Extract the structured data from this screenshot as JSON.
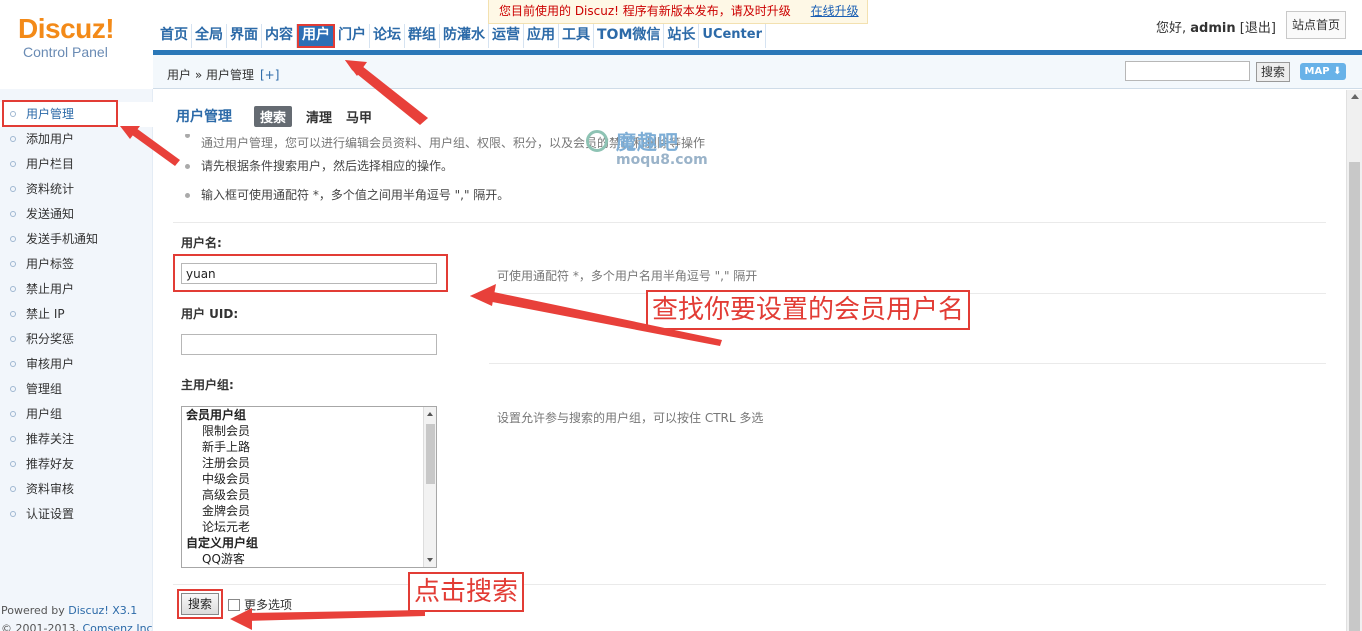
{
  "logo": {
    "brand": "Discuz!",
    "sub": "Control Panel"
  },
  "nav": [
    "首页",
    "全局",
    "界面",
    "内容",
    "用户",
    "门户",
    "论坛",
    "群组",
    "防灌水",
    "运营",
    "应用",
    "工具",
    "TOM微信",
    "站长",
    "UCenter"
  ],
  "notice": {
    "text": "您目前使用的 Discuz! 程序有新版本发布，请及时升级",
    "link": "在线升级"
  },
  "user": {
    "greeting": "您好,",
    "name": "admin",
    "logout": "[退出]",
    "site_home": "站点首页"
  },
  "breadcrumb": {
    "path": "用户 » 用户管理",
    "plus": "[+]",
    "search_button": "搜索",
    "map_button": "MAP"
  },
  "sidebar": [
    "用户管理",
    "添加用户",
    "用户栏目",
    "资料统计",
    "发送通知",
    "发送手机通知",
    "用户标签",
    "禁止用户",
    "禁止 IP",
    "积分奖惩",
    "审核用户",
    "管理组",
    "用户组",
    "推荐关注",
    "推荐好友",
    "资料审核",
    "认证设置"
  ],
  "footer": {
    "powered_prefix": "Powered by ",
    "powered_link": "Discuz! X3.1",
    "copyright_prefix": "© 2001-2013, ",
    "copyright_link": "Comsenz Inc."
  },
  "main": {
    "title": "用户管理",
    "tabs": [
      "搜索",
      "清理",
      "马甲"
    ],
    "tips": [
      "通过用户管理，您可以进行编辑会员资料、用户组、权限、积分，以及会员的禁止和删除等操作",
      "请先根据条件搜索用户，然后选择相应的操作。",
      "输入框可使用通配符 *，多个值之间用半角逗号 \",\" 隔开。"
    ],
    "watermark": {
      "title": "魔趣吧",
      "sub": "moqu8.com"
    },
    "username_label": "用户名:",
    "username_value": "yuan",
    "username_hint": "可使用通配符 *，多个用户名用半角逗号 \",\" 隔开",
    "uid_label": "用户 UID:",
    "uid_value": "",
    "group_label": "主用户组:",
    "group_hint": "设置允许参与搜索的用户组，可以按住 CTRL 多选",
    "group_options": [
      {
        "label": "会员用户组",
        "type": "grp"
      },
      {
        "label": "限制会员",
        "type": "sub"
      },
      {
        "label": "新手上路",
        "type": "sub"
      },
      {
        "label": "注册会员",
        "type": "sub"
      },
      {
        "label": "中级会员",
        "type": "sub"
      },
      {
        "label": "高级会员",
        "type": "sub"
      },
      {
        "label": "金牌会员",
        "type": "sub"
      },
      {
        "label": "论坛元老",
        "type": "sub"
      },
      {
        "label": "自定义用户组",
        "type": "grp"
      },
      {
        "label": "QQ游客",
        "type": "sub"
      }
    ],
    "search_button": "搜索",
    "more_options": "更多选项"
  },
  "annotations": {
    "find_username": "查找你要设置的会员用户名",
    "click_search": "点击搜索"
  },
  "colors": {
    "accent": "#2c6aa8",
    "annotation": "#e23c35",
    "brand": "#f38a18"
  }
}
